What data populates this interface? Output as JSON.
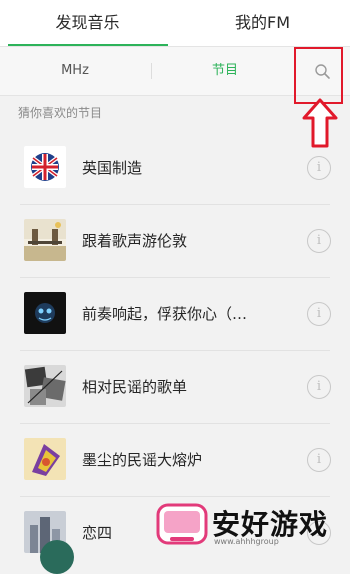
{
  "tabs": [
    {
      "label": "发现音乐",
      "active": true
    },
    {
      "label": "我的FM",
      "active": false
    }
  ],
  "subtabs": [
    {
      "label": "MHz",
      "active": false
    },
    {
      "label": "节目",
      "active": true
    }
  ],
  "section": {
    "title": "猜你喜欢的节目"
  },
  "programs": [
    {
      "title": "英国制造",
      "icon": "uk-flag-cover"
    },
    {
      "title": "跟着歌声游伦敦",
      "icon": "london-bridge-cover"
    },
    {
      "title": "前奏响起，俘获你心（…",
      "icon": "dark-cover"
    },
    {
      "title": "相对民谣的歌单",
      "icon": "collage-cover"
    },
    {
      "title": "墨尘的民谣大熔炉",
      "icon": "colorful-cover"
    },
    {
      "title": "恋四",
      "icon": "city-cover"
    }
  ],
  "colors": {
    "accent": "#2db35a",
    "highlight": "#e1192b"
  },
  "watermark": {
    "text": "安好游戏",
    "sub": "www.ahhhgroup"
  }
}
